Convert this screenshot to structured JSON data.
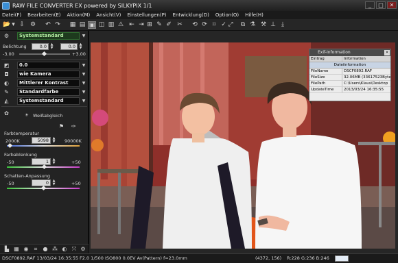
{
  "window": {
    "title": "RAW FILE CONVERTER EX powered by SILKYPIX   1/1",
    "minimize": "_",
    "maximize": "□",
    "close": "✕"
  },
  "menu": [
    {
      "label": "Datei(F)"
    },
    {
      "label": "Bearbeiten(E)"
    },
    {
      "label": "Aktion(M)"
    },
    {
      "label": "Ansicht(V)"
    },
    {
      "label": "Einstellungen(P)"
    },
    {
      "label": "Entwicklung(D)"
    },
    {
      "label": "Option(O)"
    },
    {
      "label": "Hilfe(H)"
    }
  ],
  "toolbar": [
    {
      "name": "open-folder-icon",
      "glyph": "📂"
    },
    {
      "name": "folder-menu-icon",
      "glyph": "▾"
    },
    {
      "name": "save-icon",
      "glyph": "⇩"
    },
    {
      "name": "settings-icon",
      "glyph": "⚙"
    },
    {
      "name": "undo-icon",
      "glyph": "↶"
    },
    {
      "name": "redo-icon",
      "glyph": "↷"
    },
    {
      "name": "thumbnail-view-icon",
      "glyph": "▦"
    },
    {
      "name": "preview-thumbs-icon",
      "glyph": "▤"
    },
    {
      "name": "single-view-icon",
      "glyph": "▣"
    },
    {
      "name": "compare-view-icon",
      "glyph": "◫"
    },
    {
      "name": "filmstrip-icon",
      "glyph": "▥"
    },
    {
      "name": "warning-icon",
      "glyph": "⚠"
    },
    {
      "name": "prev-icon",
      "glyph": "⇤"
    },
    {
      "name": "next-icon",
      "glyph": "⇥"
    },
    {
      "name": "grid-icon",
      "glyph": "⊞"
    },
    {
      "name": "pick-gray-icon",
      "glyph": "✎"
    },
    {
      "name": "pick-white-icon",
      "glyph": "✐"
    },
    {
      "name": "retouch-icon",
      "glyph": "✂"
    },
    {
      "name": "rotate-left-icon",
      "glyph": "⟲"
    },
    {
      "name": "rotate-right-icon",
      "glyph": "⟳"
    },
    {
      "name": "crop-icon",
      "glyph": "⌗"
    },
    {
      "name": "check-icon",
      "glyph": "✓"
    },
    {
      "name": "tilt-icon",
      "glyph": "⤢"
    },
    {
      "name": "clone-icon",
      "glyph": "⧉"
    },
    {
      "name": "develop-icon",
      "glyph": "⚗"
    },
    {
      "name": "hammer-icon",
      "glyph": "⚒"
    },
    {
      "name": "dropper-icon",
      "glyph": "⊥"
    },
    {
      "name": "export-icon",
      "glyph": "⤓"
    }
  ],
  "panel": {
    "preset": "Systemstandard",
    "exposure_label": "Belichtung",
    "exposure_value": "0.0",
    "exposure_value2": "0.0",
    "exposure_min": "-3.00",
    "exposure_max": "+3.00",
    "row_value": "0.0",
    "camera": "wie Kamera",
    "contrast": "Mittlerer Kontrast",
    "color": "Standardfarbe",
    "sharpness": "Systemstandard",
    "wb_label": "Weißabgleich",
    "color_temp_label": "Farbtemperatur",
    "color_temp_min": "2000K",
    "color_temp_value": "5098",
    "color_temp_max": "90000K",
    "color_temp_level": 0.04,
    "color_dev_label": "Farbablenkung",
    "color_dev_min": "-50",
    "color_dev_value": "1",
    "color_dev_max": "+50",
    "color_dev_level": 0.51,
    "shadow_label": "Schatten-Anpassung",
    "shadow_min": "-50",
    "shadow_value": "0",
    "shadow_max": "+50",
    "shadow_level": 0.5
  },
  "bottom_icons": [
    {
      "name": "histogram-icon",
      "glyph": "▙"
    },
    {
      "name": "film-icon",
      "glyph": "▦"
    },
    {
      "name": "lens-icon",
      "glyph": "◉"
    },
    {
      "name": "crop-tool-icon",
      "glyph": "⌗"
    },
    {
      "name": "sphere-icon",
      "glyph": "●"
    },
    {
      "name": "noise-icon",
      "glyph": "⁂"
    },
    {
      "name": "color-icon",
      "glyph": "◐"
    },
    {
      "name": "fit-icon",
      "glyph": "⤧"
    },
    {
      "name": "develop-settings-icon",
      "glyph": "⚙"
    }
  ],
  "exif": {
    "title": "Exif-Information",
    "col_entry": "Eintrag",
    "col_info": "Information",
    "section": "Dateiinformation",
    "rows": [
      {
        "k": "FileName",
        "v": "DSCF0892.RAF"
      },
      {
        "k": "FileSize",
        "v": "32.06MB (33617523Byte)"
      },
      {
        "k": "FilePath",
        "v": "C:\\Users\\Klaus\\Desktop"
      },
      {
        "k": "UpdateTime",
        "v": "2013/03/24 16:35:55"
      }
    ]
  },
  "status": {
    "info": "DSCF0892.RAF 13/03/24 16:35:55 F2.0 1/500 ISO800 0.0EV Av(Pattern) f=23.0mm",
    "coords": "(4372, 156)",
    "rgb": "R:228 G:236 B:246"
  },
  "colors": {
    "accent_green": "#1d3a1d",
    "preset_text": "#b8f0a6"
  }
}
